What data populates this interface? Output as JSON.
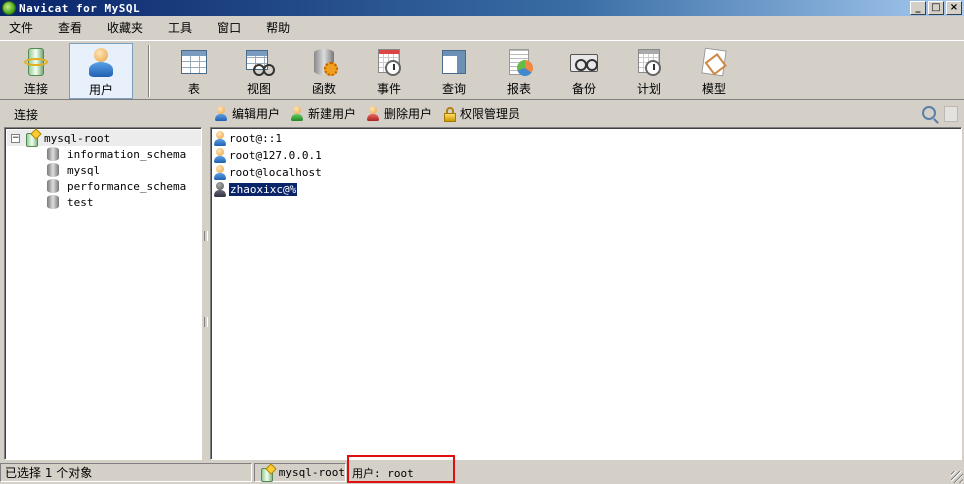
{
  "window": {
    "title": "Navicat for MySQL",
    "controls": {
      "minimize": "_",
      "maximize": "□",
      "close": "×"
    }
  },
  "menu": [
    "文件",
    "查看",
    "收藏夹",
    "工具",
    "窗口",
    "帮助"
  ],
  "toolbar": {
    "buttons": [
      {
        "label": "连接",
        "icon": "connect-icon"
      },
      {
        "label": "用户",
        "icon": "user-icon",
        "active": true
      },
      {
        "label": "表",
        "icon": "table-icon"
      },
      {
        "label": "视图",
        "icon": "view-icon"
      },
      {
        "label": "函数",
        "icon": "function-icon"
      },
      {
        "label": "事件",
        "icon": "event-icon"
      },
      {
        "label": "查询",
        "icon": "query-icon"
      },
      {
        "label": "报表",
        "icon": "report-icon"
      },
      {
        "label": "备份",
        "icon": "backup-icon"
      },
      {
        "label": "计划",
        "icon": "schedule-icon"
      },
      {
        "label": "模型",
        "icon": "model-icon"
      }
    ]
  },
  "subheader": {
    "connections_label": "连接",
    "actions": [
      {
        "label": "编辑用户",
        "icon": "edit-user-icon"
      },
      {
        "label": "新建用户",
        "icon": "new-user-icon"
      },
      {
        "label": "删除用户",
        "icon": "delete-user-icon"
      },
      {
        "label": "权限管理员",
        "icon": "lock-icon"
      }
    ]
  },
  "tree": {
    "connection": "mysql-root",
    "expander": "−",
    "databases": [
      "information_schema",
      "mysql",
      "performance_schema",
      "test"
    ]
  },
  "users": [
    {
      "name": "root@::1",
      "selected": false
    },
    {
      "name": "root@127.0.0.1",
      "selected": false
    },
    {
      "name": "root@localhost",
      "selected": false
    },
    {
      "name": "zhaoxixc@%",
      "selected": true
    }
  ],
  "status": {
    "selection": "已选择 1 个对象",
    "connection": "mysql-root",
    "user": "用户: root"
  },
  "colors": {
    "selection": "#0a246a",
    "highlight_box": "#e01010",
    "titlebar": "#0a246a"
  }
}
